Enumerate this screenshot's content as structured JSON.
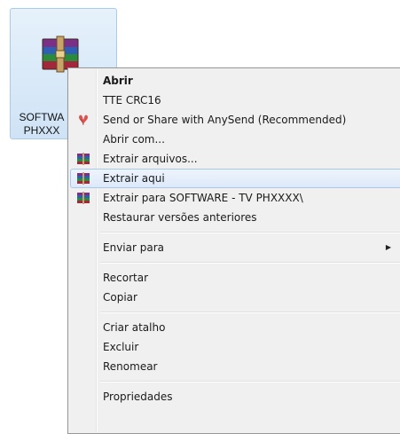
{
  "desktop": {
    "file_label_line1": "SOFTWA",
    "file_label_line2": "PHXXX"
  },
  "menu": {
    "items": [
      {
        "label": "Abrir",
        "icon": null,
        "bold": true
      },
      {
        "label": "TTE CRC16",
        "icon": null
      },
      {
        "label": "Send or Share with AnySend (Recommended)",
        "icon": "anysend-icon"
      },
      {
        "label": "Abrir com...",
        "icon": null
      },
      {
        "label": "Extrair arquivos...",
        "icon": "winrar-icon"
      },
      {
        "label": "Extrair aqui",
        "icon": "winrar-icon",
        "highlighted": true
      },
      {
        "label": "Extrair para SOFTWARE - TV PHXXXX\\",
        "icon": "winrar-icon"
      },
      {
        "label": "Restaurar versões anteriores",
        "icon": null
      },
      {
        "label": "Enviar para",
        "icon": null,
        "submenu": true
      },
      {
        "label": "Recortar",
        "icon": null
      },
      {
        "label": "Copiar",
        "icon": null
      },
      {
        "label": "Criar atalho",
        "icon": null
      },
      {
        "label": "Excluir",
        "icon": null
      },
      {
        "label": "Renomear",
        "icon": null
      },
      {
        "label": "Propriedades",
        "icon": null
      }
    ]
  },
  "colors": {
    "highlight_border": "#a8c8ee",
    "menu_background": "#f0f0f0",
    "selection_background": "#cfe3f6"
  }
}
